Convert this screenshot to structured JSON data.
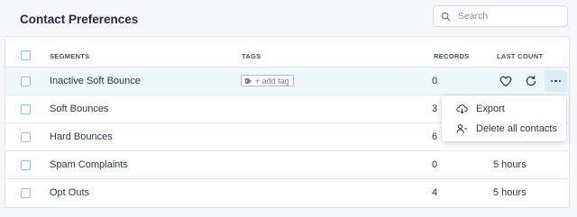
{
  "page": {
    "title": "Contact Preferences"
  },
  "search": {
    "placeholder": "Search",
    "value": ""
  },
  "table": {
    "headers": {
      "segments": "SEGMENTS",
      "tags": "TAGS",
      "records": "RECORDS",
      "last_count": "LAST COUNT"
    },
    "rows": [
      {
        "segment": "Inactive Soft Bounce",
        "tag": "+ add tag",
        "records": "0",
        "last_count": ""
      },
      {
        "segment": "Soft Bounces",
        "records": "3",
        "last_count": ""
      },
      {
        "segment": "Hard Bounces",
        "records": "6",
        "last_count": ""
      },
      {
        "segment": "Spam Complaints",
        "records": "0",
        "last_count": "5 hours"
      },
      {
        "segment": "Opt Outs",
        "records": "4",
        "last_count": "5 hours"
      }
    ]
  },
  "row_actions": {
    "icons": [
      "heart-icon",
      "refresh-icon",
      "more-horizontal-icon"
    ]
  },
  "menu": {
    "items": [
      {
        "label": "Export",
        "icon": "cloud-download-icon"
      },
      {
        "label": "Delete all contacts",
        "icon": "user-minus-icon"
      }
    ]
  },
  "colors": {
    "accent": "#7ec9d6",
    "highlight_row": "#eef8fa",
    "more_button_bg": "#d9eef3"
  }
}
